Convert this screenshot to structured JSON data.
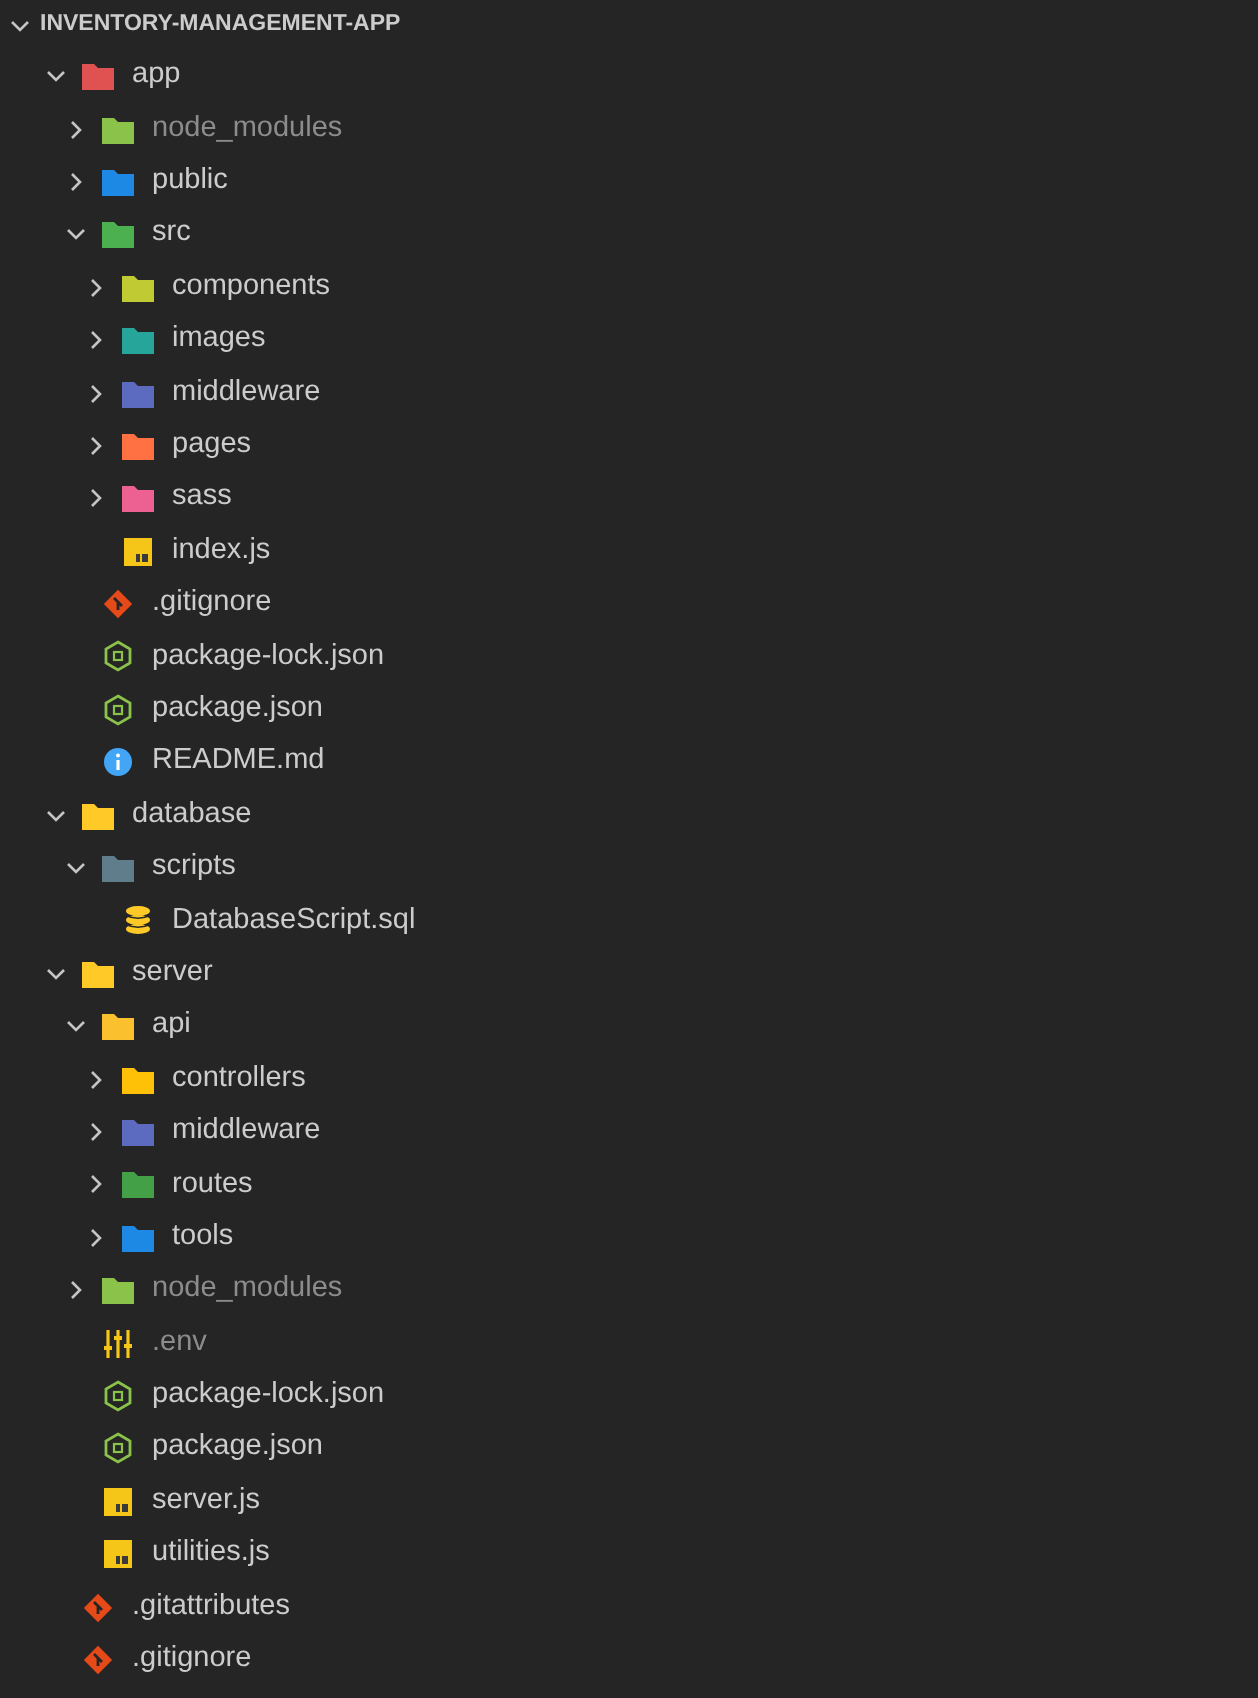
{
  "explorer": {
    "title": "INVENTORY-MANAGEMENT-APP",
    "expanded": true,
    "tree": [
      {
        "name": "app",
        "kind": "folder",
        "color": "#e05252",
        "expanded": true,
        "ignored": false,
        "children": [
          {
            "name": "node_modules",
            "kind": "folder",
            "color": "#8bc34a",
            "expanded": false,
            "ignored": true
          },
          {
            "name": "public",
            "kind": "folder",
            "color": "#1e88e5",
            "expanded": false,
            "ignored": false
          },
          {
            "name": "src",
            "kind": "folder",
            "color": "#4caf50",
            "expanded": true,
            "ignored": false,
            "children": [
              {
                "name": "components",
                "kind": "folder",
                "color": "#c0ca33",
                "expanded": false,
                "ignored": false
              },
              {
                "name": "images",
                "kind": "folder",
                "color": "#26a69a",
                "expanded": false,
                "ignored": false
              },
              {
                "name": "middleware",
                "kind": "folder",
                "color": "#5c6bc0",
                "expanded": false,
                "ignored": false
              },
              {
                "name": "pages",
                "kind": "folder",
                "color": "#ff7043",
                "expanded": false,
                "ignored": false
              },
              {
                "name": "sass",
                "kind": "folder",
                "color": "#ec6192",
                "expanded": false,
                "ignored": false
              },
              {
                "name": "index.js",
                "kind": "js",
                "ignored": false
              }
            ]
          },
          {
            "name": ".gitignore",
            "kind": "git",
            "ignored": false
          },
          {
            "name": "package-lock.json",
            "kind": "node",
            "ignored": false
          },
          {
            "name": "package.json",
            "kind": "node",
            "ignored": false
          },
          {
            "name": "README.md",
            "kind": "info",
            "ignored": false
          }
        ]
      },
      {
        "name": "database",
        "kind": "folder",
        "color": "#ffca28",
        "expanded": true,
        "ignored": false,
        "children": [
          {
            "name": "scripts",
            "kind": "folder",
            "color": "#607d8b",
            "expanded": true,
            "ignored": false,
            "children": [
              {
                "name": "DatabaseScript.sql",
                "kind": "sql",
                "ignored": false
              }
            ]
          }
        ]
      },
      {
        "name": "server",
        "kind": "folder",
        "color": "#ffca28",
        "expanded": true,
        "ignored": false,
        "children": [
          {
            "name": "api",
            "kind": "folder",
            "color": "#fbc02d",
            "expanded": true,
            "ignored": false,
            "children": [
              {
                "name": "controllers",
                "kind": "folder",
                "color": "#ffc107",
                "expanded": false,
                "ignored": false
              },
              {
                "name": "middleware",
                "kind": "folder",
                "color": "#5c6bc0",
                "expanded": false,
                "ignored": false
              },
              {
                "name": "routes",
                "kind": "folder",
                "color": "#43a047",
                "expanded": false,
                "ignored": false
              },
              {
                "name": "tools",
                "kind": "folder",
                "color": "#1e88e5",
                "expanded": false,
                "ignored": false
              }
            ]
          },
          {
            "name": "node_modules",
            "kind": "folder",
            "color": "#8bc34a",
            "expanded": false,
            "ignored": true
          },
          {
            "name": ".env",
            "kind": "env",
            "ignored": true
          },
          {
            "name": "package-lock.json",
            "kind": "node",
            "ignored": false
          },
          {
            "name": "package.json",
            "kind": "node",
            "ignored": false
          },
          {
            "name": "server.js",
            "kind": "js",
            "ignored": false
          },
          {
            "name": "utilities.js",
            "kind": "js",
            "ignored": false
          }
        ]
      },
      {
        "name": ".gitattributes",
        "kind": "git",
        "ignored": false
      },
      {
        "name": ".gitignore",
        "kind": "git",
        "ignored": false
      }
    ]
  }
}
